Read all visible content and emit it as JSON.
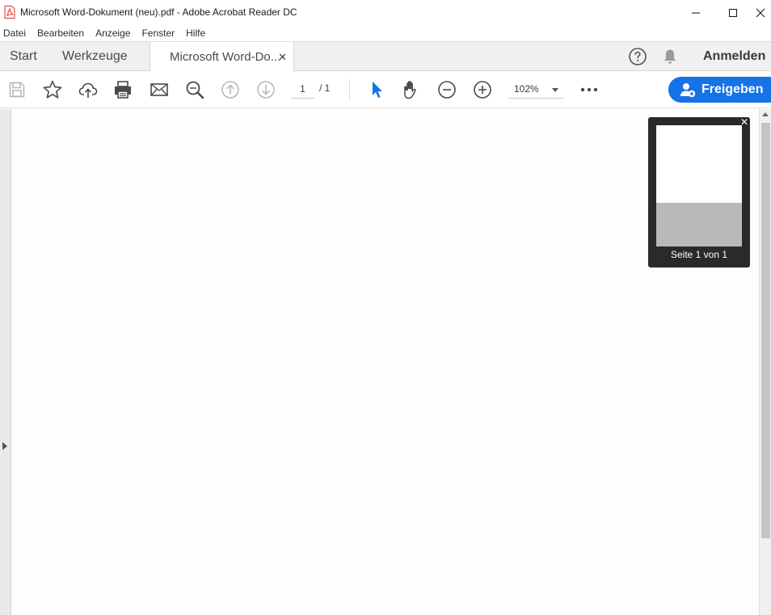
{
  "window": {
    "title": "Microsoft Word-Dokument (neu).pdf - Adobe Acrobat Reader DC"
  },
  "menu": [
    "Datei",
    "Bearbeiten",
    "Anzeige",
    "Fenster",
    "Hilfe"
  ],
  "tabs": {
    "start": "Start",
    "tools": "Werkzeuge",
    "document": "Microsoft Word-Do...",
    "close_glyph": "✕"
  },
  "header": {
    "signin": "Anmelden"
  },
  "toolbar": {
    "page_current": "1",
    "page_total": "/ 1",
    "zoom": "102%",
    "share": "Freigeben"
  },
  "thumbnail": {
    "label": "Seite 1 von 1",
    "close_glyph": "✕"
  },
  "colors": {
    "accent": "#1473e6",
    "select_tool": "#1473e6",
    "pdf_icon": "#d93025"
  }
}
